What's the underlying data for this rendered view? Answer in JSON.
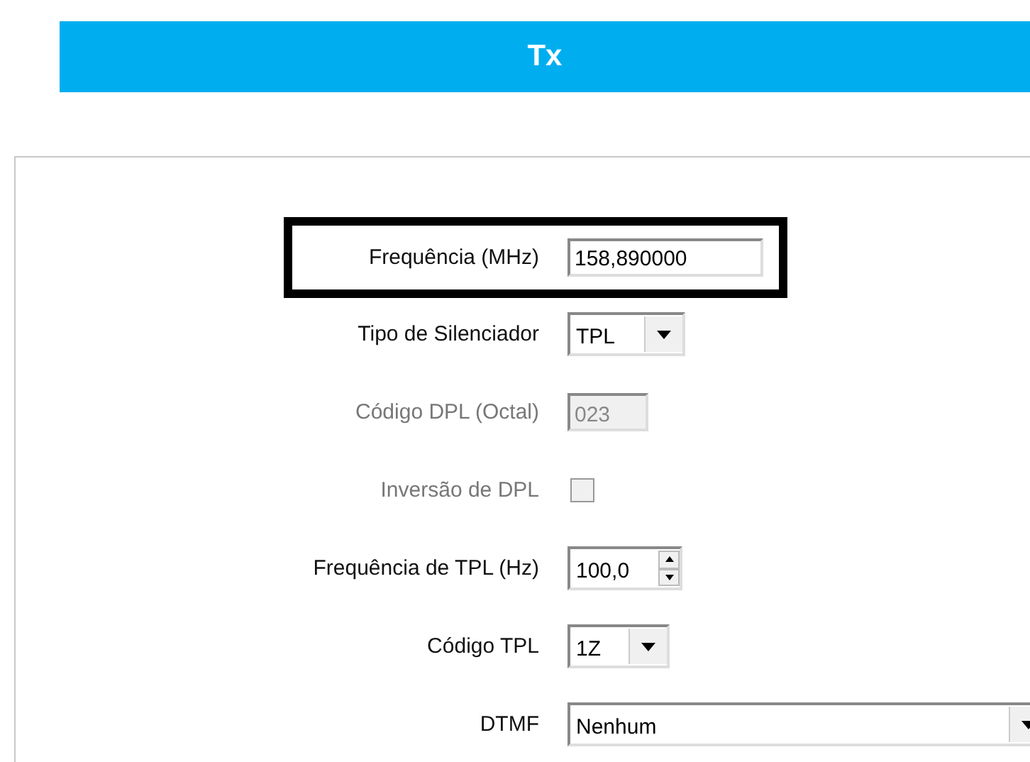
{
  "header": {
    "title": "Tx"
  },
  "fields": [
    {
      "kind": "text",
      "label": "Frequência (MHz)",
      "value": "158,890000",
      "disabled": false,
      "highlighted": true
    },
    {
      "kind": "select",
      "label": "Tipo de Silenciador",
      "value": "TPL",
      "disabled": false,
      "highlighted": false
    },
    {
      "kind": "text",
      "label": "Código DPL (Octal)",
      "value": "023",
      "disabled": true,
      "highlighted": false
    },
    {
      "kind": "checkbox",
      "label": "Inversão de DPL",
      "checked": false,
      "disabled": true,
      "highlighted": false
    },
    {
      "kind": "spinner",
      "label": "Frequência de TPL (Hz)",
      "value": "100,0",
      "disabled": false,
      "highlighted": false
    },
    {
      "kind": "select",
      "label": "Código TPL",
      "value": "1Z",
      "disabled": false,
      "highlighted": false
    },
    {
      "kind": "wideselect",
      "label": "DTMF",
      "value": "Nenhum",
      "disabled": false,
      "highlighted": false
    }
  ]
}
